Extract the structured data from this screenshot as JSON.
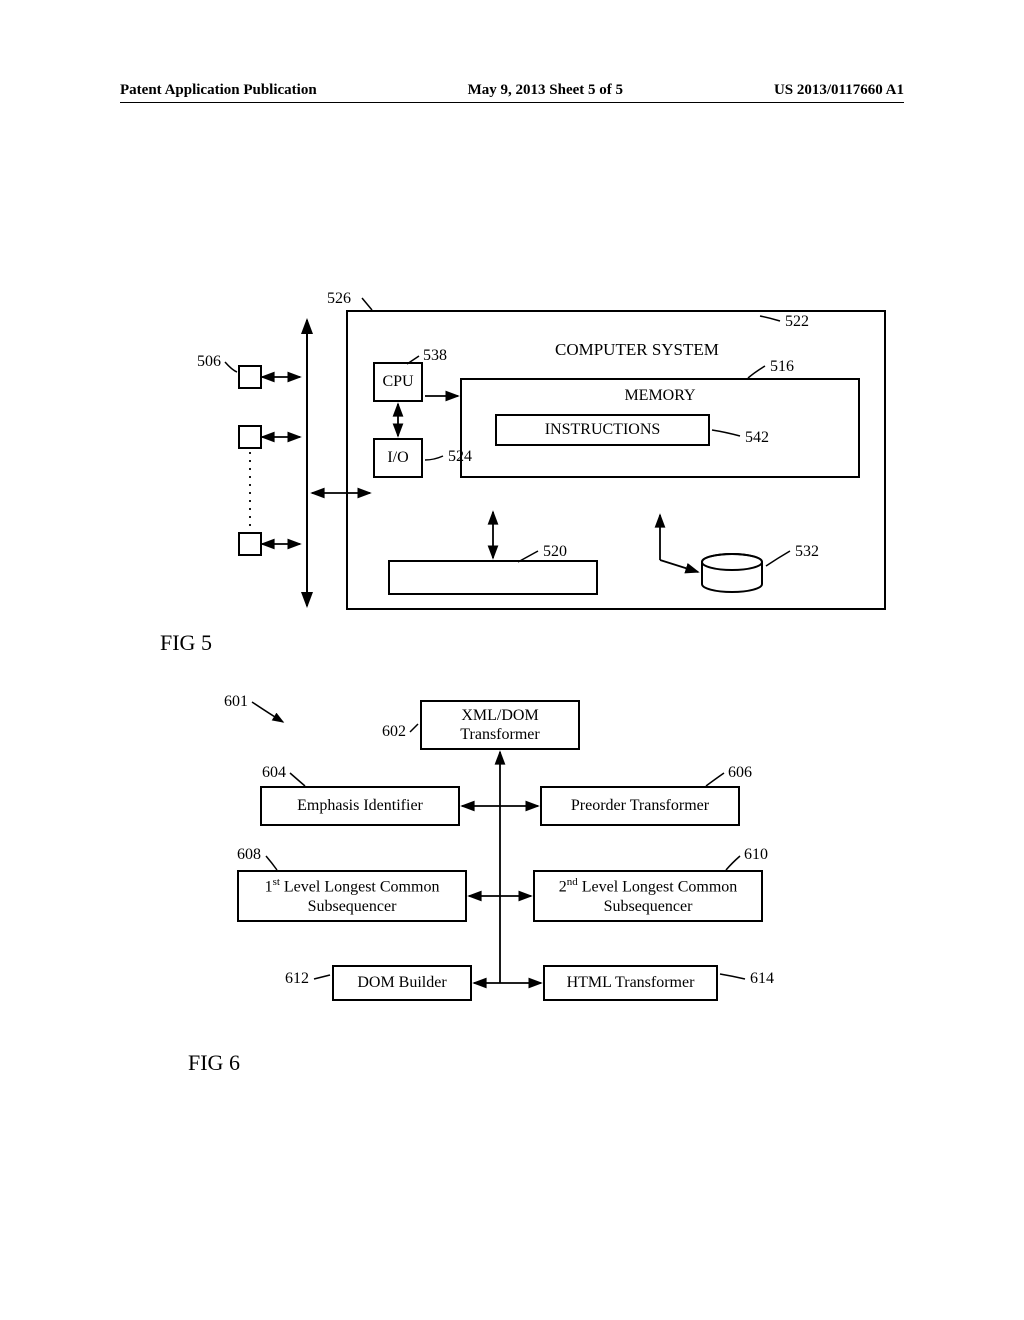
{
  "header": {
    "left": "Patent Application Publication",
    "center": "May 9, 2013  Sheet 5 of 5",
    "right": "US 2013/0117660 A1"
  },
  "fig5": {
    "caption": "FIG 5",
    "outer_title": "COMPUTER SYSTEM",
    "cpu": "CPU",
    "io": "I/O",
    "memory": "MEMORY",
    "instructions": "INSTRUCTIONS",
    "refs": {
      "r506": "506",
      "r522": "522",
      "r526": "526",
      "r538": "538",
      "r516": "516",
      "r524": "524",
      "r542": "542",
      "r520": "520",
      "r532": "532"
    }
  },
  "fig6": {
    "caption": "FIG 6",
    "b602": "XML/DOM Transformer",
    "b604": "Emphasis Identifier",
    "b606": "Preorder Transformer",
    "b608_pre": "1",
    "b608_sup": "st",
    "b608_rest": " Level Longest Common Subsequencer",
    "b610_pre": "2",
    "b610_sup": "nd",
    "b610_rest": " Level Longest Common Subsequencer",
    "b612": "DOM Builder",
    "b614": "HTML Transformer",
    "refs": {
      "r601": "601",
      "r602": "602",
      "r604": "604",
      "r606": "606",
      "r608": "608",
      "r610": "610",
      "r612": "612",
      "r614": "614"
    }
  }
}
